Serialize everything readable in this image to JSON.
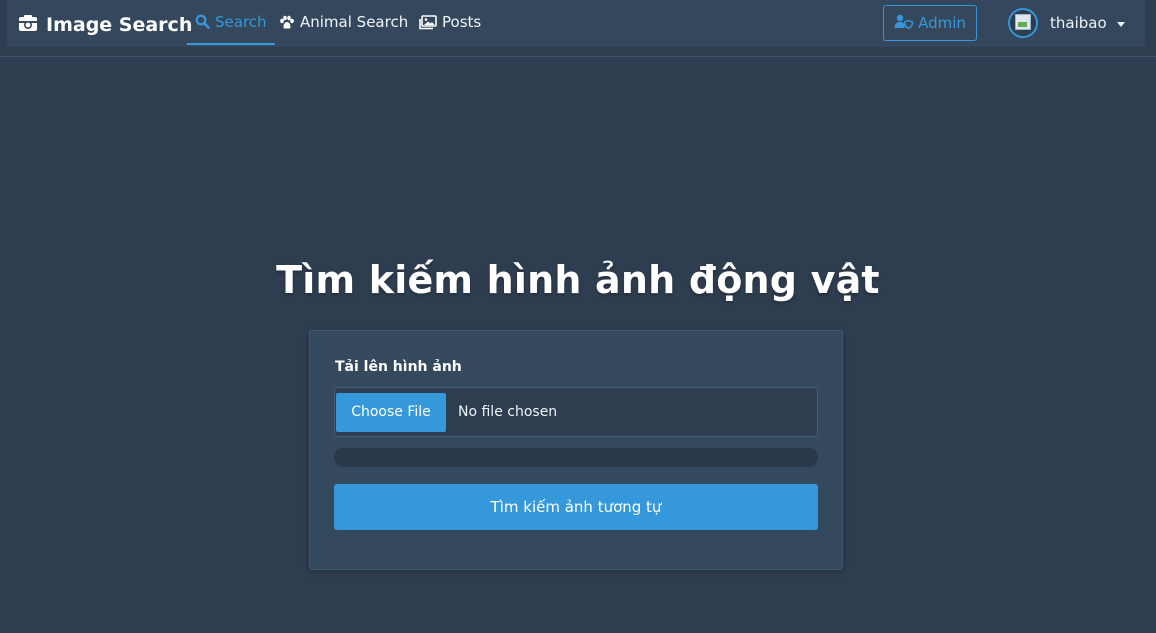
{
  "navbar": {
    "brand": "Image Search",
    "links": [
      {
        "label": "Search",
        "icon": "search-icon",
        "active": true
      },
      {
        "label": "Animal Search",
        "icon": "paw-icon",
        "active": false
      },
      {
        "label": "Posts",
        "icon": "images-icon",
        "active": false
      }
    ],
    "admin_label": "Admin",
    "username": "thaibao"
  },
  "main": {
    "title": "Tìm kiếm hình ảnh động vật",
    "upload_label": "Tải lên hình ảnh",
    "file_button_label": "Choose File",
    "file_status": "No file chosen",
    "progress": 0,
    "search_button_label": "Tìm kiếm ảnh tương tự"
  },
  "colors": {
    "background": "#2e3d50",
    "accent": "#3498db",
    "card": "#34495e"
  }
}
